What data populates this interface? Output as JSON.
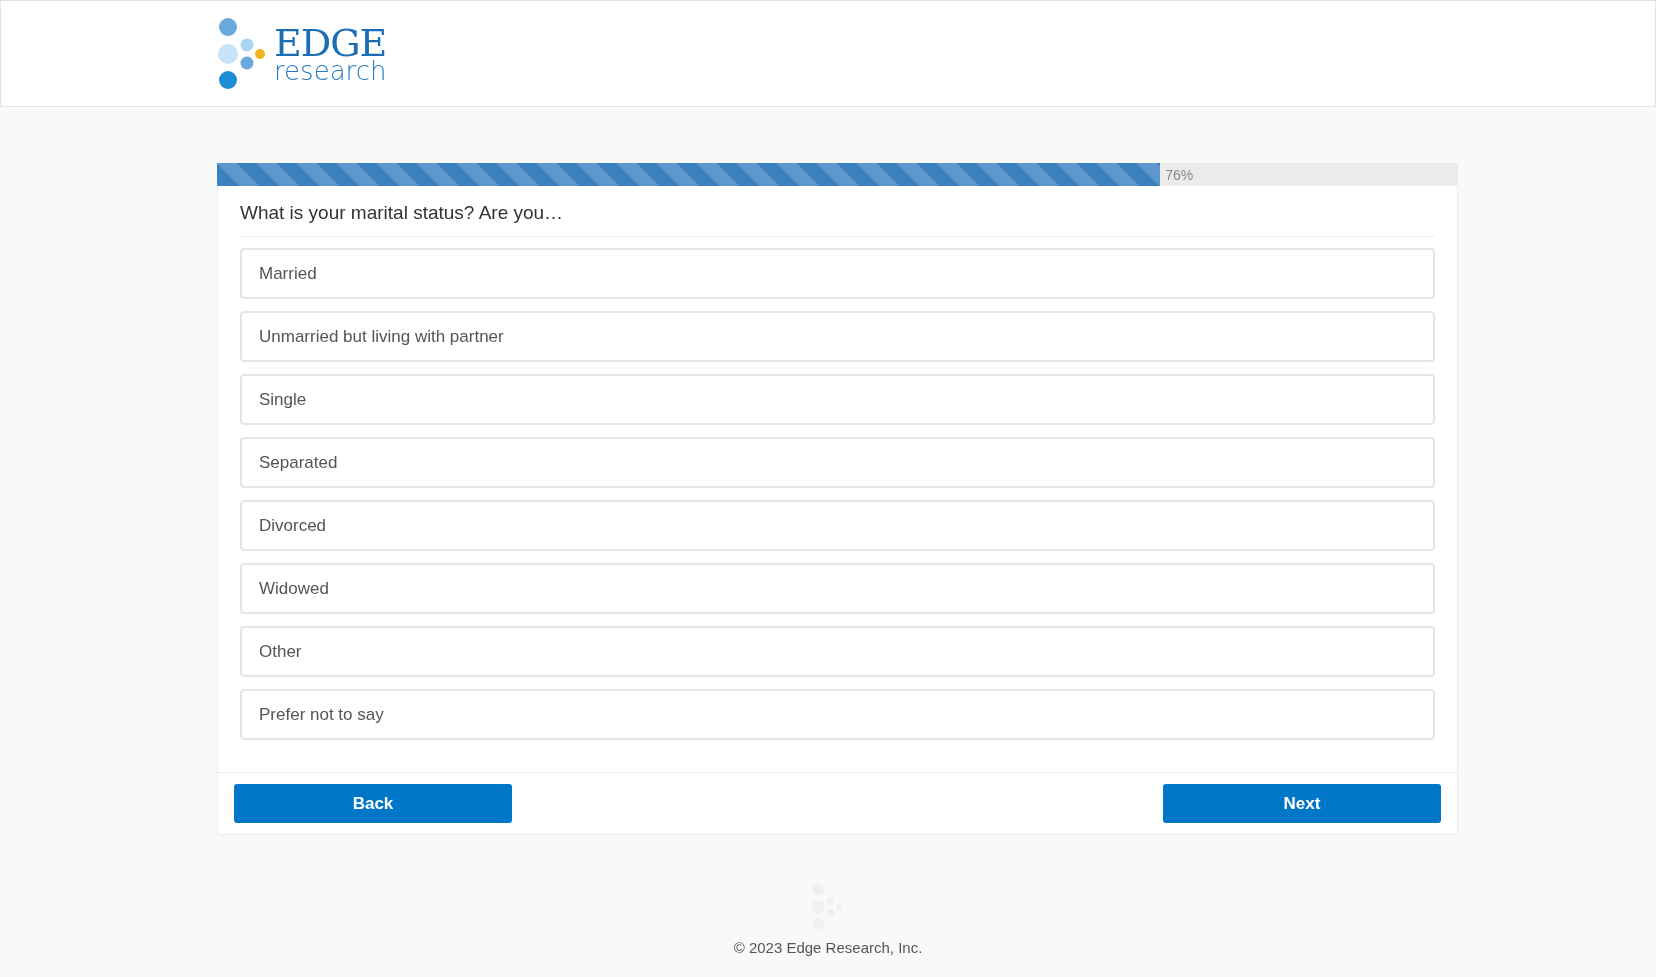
{
  "header": {
    "logo": {
      "word": "EDGE",
      "subword": "research"
    }
  },
  "progress": {
    "level": 0.76,
    "label": "76%"
  },
  "question": "What is your marital status? Are you…",
  "options": [
    {
      "label": "Married",
      "selected": false
    },
    {
      "label": "Unmarried but living with partner",
      "selected": false
    },
    {
      "label": "Single",
      "selected": false
    },
    {
      "label": "Separated",
      "selected": false
    },
    {
      "label": "Divorced",
      "selected": false
    },
    {
      "label": "Widowed",
      "selected": false
    },
    {
      "label": "Other",
      "selected": false
    },
    {
      "label": "Prefer not to say",
      "selected": false
    }
  ],
  "buttons": {
    "back": "Back",
    "next": "Next"
  },
  "footer": {
    "copyright": "© 2023 Edge Research, Inc."
  }
}
